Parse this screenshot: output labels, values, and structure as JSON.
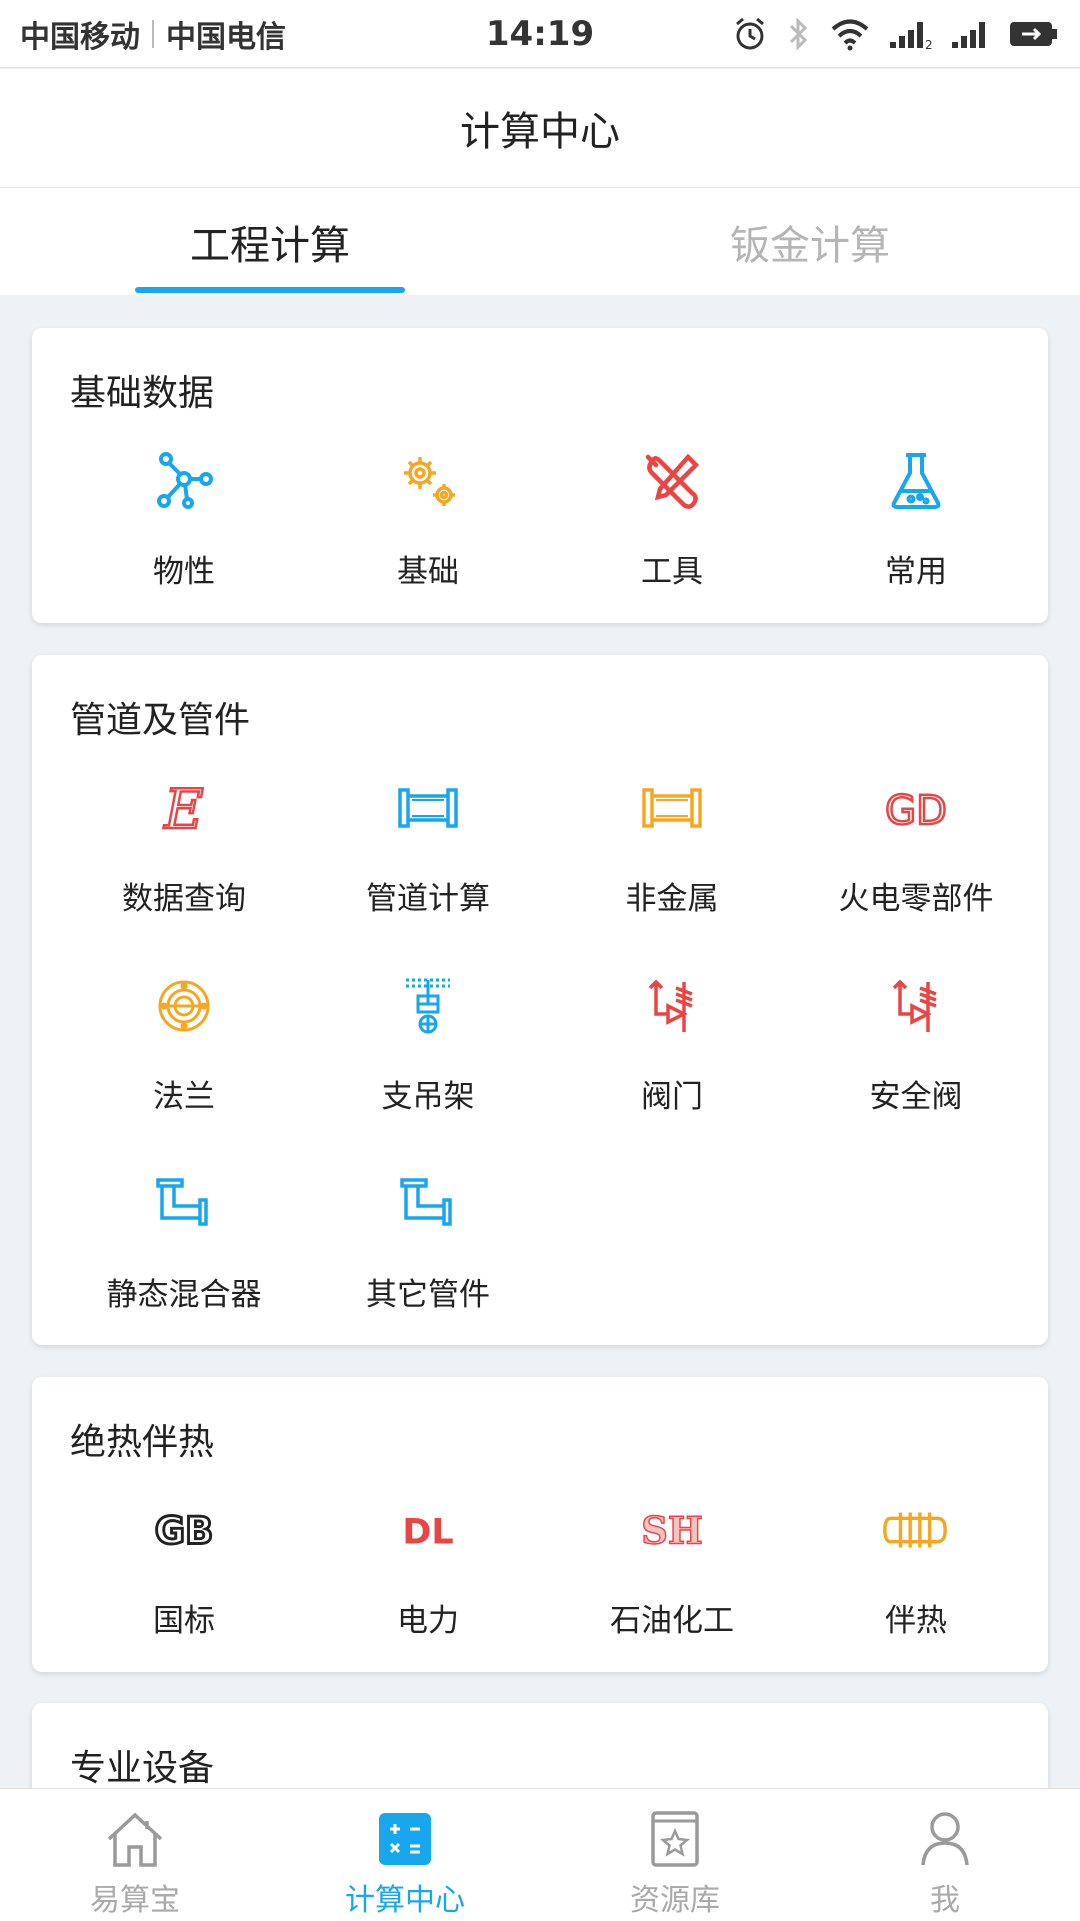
{
  "status_bar": {
    "carrier1": "中国移动",
    "carrier2": "中国电信",
    "time": "14:19",
    "signal_badge": "2"
  },
  "header": {
    "title": "计算中心"
  },
  "tabs": [
    {
      "label": "工程计算",
      "active": true
    },
    {
      "label": "钣金计算",
      "active": false
    }
  ],
  "sections": [
    {
      "title": "基础数据",
      "items": [
        {
          "label": "物性",
          "icon": "molecule-icon",
          "color": "#18a6ee"
        },
        {
          "label": "基础",
          "icon": "gears-icon",
          "color": "#f5a623"
        },
        {
          "label": "工具",
          "icon": "wrench-screwdriver-icon",
          "color": "#e84545"
        },
        {
          "label": "常用",
          "icon": "flask-icon",
          "color": "#18a6ee"
        }
      ]
    },
    {
      "title": "管道及管件",
      "items": [
        {
          "label": "数据查询",
          "icon": "letter-e-icon",
          "glyph": "E",
          "color": "#e84545"
        },
        {
          "label": "管道计算",
          "icon": "pipe-icon",
          "color": "#18a6ee"
        },
        {
          "label": "非金属",
          "icon": "pipe-icon",
          "color": "#f5a623"
        },
        {
          "label": "火电零部件",
          "icon": "gd-text-icon",
          "glyph": "GD",
          "color": "#e84545"
        },
        {
          "label": "法兰",
          "icon": "flange-icon",
          "color": "#f5a623"
        },
        {
          "label": "支吊架",
          "icon": "hanger-icon",
          "color": "#18a6ee"
        },
        {
          "label": "阀门",
          "icon": "valve-icon",
          "color": "#e84545"
        },
        {
          "label": "安全阀",
          "icon": "valve-icon",
          "color": "#e84545"
        },
        {
          "label": "静态混合器",
          "icon": "pipe-elbow-icon",
          "color": "#18a6ee"
        },
        {
          "label": "其它管件",
          "icon": "pipe-elbow-icon",
          "color": "#18a6ee"
        }
      ]
    },
    {
      "title": "绝热伴热",
      "items": [
        {
          "label": "国标",
          "icon": "gb-text-icon",
          "glyph": "GB",
          "color": "#222222"
        },
        {
          "label": "电力",
          "icon": "dl-text-icon",
          "glyph": "DL",
          "color": "#e84545"
        },
        {
          "label": "石油化工",
          "icon": "sh-text-icon",
          "glyph": "SH",
          "color": "#e84545"
        },
        {
          "label": "伴热",
          "icon": "heat-trace-icon",
          "color": "#f5a623"
        }
      ]
    },
    {
      "title": "专业设备",
      "items": []
    }
  ],
  "bottom_nav": [
    {
      "label": "易算宝",
      "icon": "house-icon",
      "active": false
    },
    {
      "label": "计算中心",
      "icon": "calculator-icon",
      "active": true
    },
    {
      "label": "资源库",
      "icon": "book-star-icon",
      "active": false
    },
    {
      "label": "我",
      "icon": "person-icon",
      "active": false
    }
  ],
  "colors": {
    "accent": "#18a6ee",
    "orange": "#f5a623",
    "red": "#e84545",
    "background": "#eef2f5"
  }
}
